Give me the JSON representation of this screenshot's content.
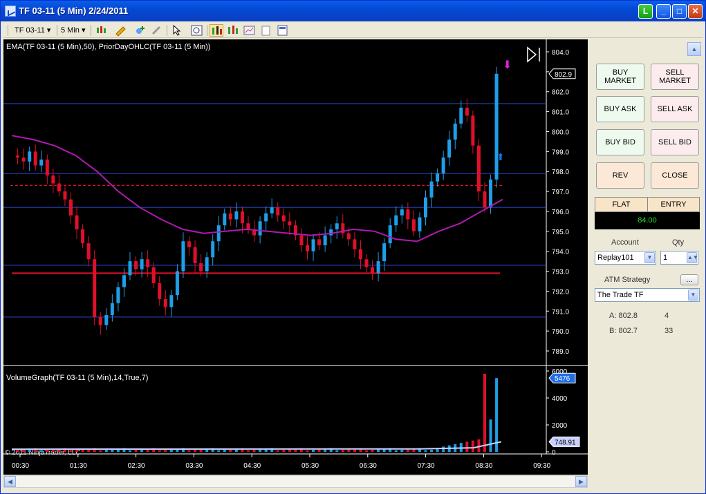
{
  "window": {
    "title": "TF 03-11 (5 Min)  2/24/2011",
    "badge": "L",
    "min": "_",
    "max": "□",
    "close": "✕"
  },
  "toolbar": {
    "instrument": "TF 03-11",
    "interval": "5 Min",
    "instrument_arrow": "▾",
    "interval_arrow": "▾"
  },
  "indicator_label": "EMA(TF 03-11 (5 Min),50), PriorDayOHLC(TF 03-11 (5 Min))",
  "volume_label": "VolumeGraph(TF 03-11 (5 Min),14,True,7)",
  "copyright": "© 2011 NinjaTrader, LLC",
  "price_axis": [
    "804.0",
    "803.0",
    "802.0",
    "801.0",
    "800.0",
    "799.0",
    "798.0",
    "797.0",
    "796.0",
    "795.0",
    "794.0",
    "793.0",
    "792.0",
    "791.0",
    "790.0",
    "789.0"
  ],
  "price_marker": "802.9",
  "volume_axis": [
    "6000",
    "4000",
    "2000",
    "0"
  ],
  "volume_marker": "5476",
  "volume_avg_marker": "748.91",
  "time_axis": [
    "00:30",
    "01:30",
    "02:30",
    "03:30",
    "04:30",
    "05:30",
    "06:30",
    "07:30",
    "08:30",
    "09:30"
  ],
  "chart_data": {
    "type": "candlestick",
    "ylim": [
      788.5,
      804.3
    ],
    "volume_ylim": [
      0,
      6000
    ],
    "ema_value_end": 796.6,
    "prior_day_levels": [
      801.4,
      797.9,
      797.3,
      796.2,
      793.3,
      792.9,
      790.7
    ],
    "last_price": 802.9,
    "last_volume": 5476,
    "volume_avg": 748.91
  },
  "panel": {
    "buy_market": "BUY MARKET",
    "sell_market": "SELL MARKET",
    "buy_ask": "BUY ASK",
    "sell_ask": "SELL ASK",
    "buy_bid": "BUY BID",
    "sell_bid": "SELL BID",
    "rev": "REV",
    "close": "CLOSE",
    "flat": "FLAT",
    "entry": "ENTRY",
    "position_value": "84.00",
    "account_label": "Account",
    "qty_label": "Qty",
    "account": "Replay101",
    "qty": "1",
    "atm_label": "ATM Strategy",
    "atm_btn": "...",
    "atm": "The Trade TF",
    "ask_label": "A: 802.8",
    "ask_size": "4",
    "bid_label": "B: 802.7",
    "bid_size": "33",
    "up_arrow": "▲"
  },
  "colors": {
    "up": "#1e9fe8",
    "down": "#e0102a",
    "ema": "#b01ab0",
    "level": "#2a4bd6",
    "prior_close": "#e0102a"
  }
}
